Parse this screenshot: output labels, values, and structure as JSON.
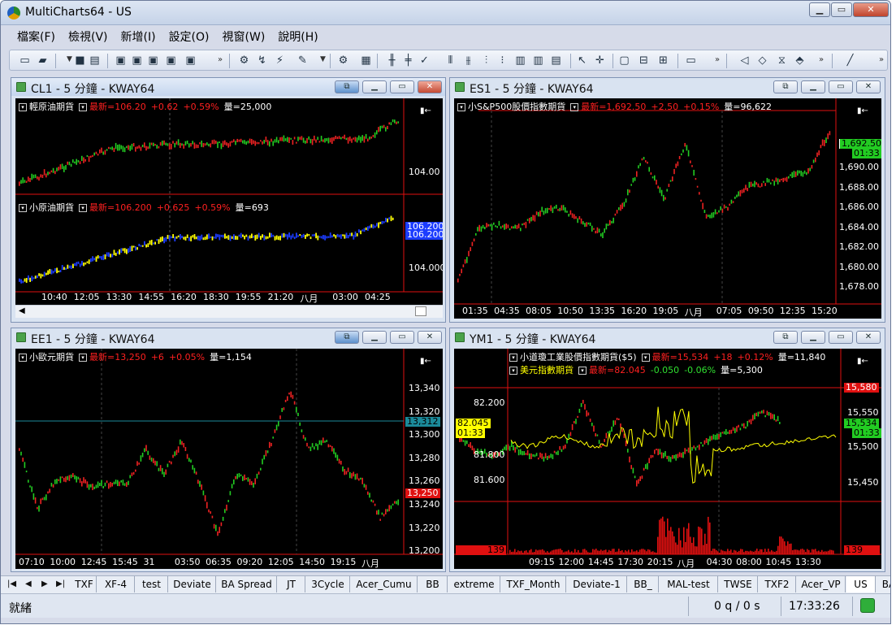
{
  "app": {
    "title": "MultiCharts64 - US"
  },
  "menu": [
    "檔案(F)",
    "檢視(V)",
    "新增(I)",
    "設定(O)",
    "視窗(W)",
    "說明(H)"
  ],
  "windows": [
    {
      "caption": "CL1 - 5 分鐘 - KWAY64",
      "legend1": {
        "name": "輕原油期貨",
        "last": "最新=106.20",
        "chg": "+0.62",
        "pct": "+0.59%",
        "vol": "量=25,000"
      },
      "legend2": {
        "name": "小原油期貨",
        "last": "最新=106.200",
        "chg": "+0.625",
        "pct": "+0.59%",
        "vol": "量=693"
      },
      "yticks1": [
        "104.00"
      ],
      "yticks2": [
        "104.000"
      ],
      "tags": [
        "106.200",
        "106.200"
      ],
      "xticks": [
        "10:40",
        "12:05",
        "13:30",
        "14:55",
        "16:20",
        "18:30",
        "19:55",
        "21:20",
        "八月",
        "03:00",
        "04:25"
      ]
    },
    {
      "caption": "ES1 - 5 分鐘 - KWAY64",
      "legend1": {
        "name": "小S&P500股價指數期貨",
        "last": "最新=1,692.50",
        "chg": "+2.50",
        "pct": "+0.15%",
        "vol": "量=96,622"
      },
      "yticks": [
        "1,690.00",
        "1,688.00",
        "1,686.00",
        "1,684.00",
        "1,682.00",
        "1,680.00",
        "1,678.00"
      ],
      "tags": [
        "1,692.50",
        "01:33"
      ],
      "xticks": [
        "01:35",
        "04:35",
        "08:05",
        "10:50",
        "13:35",
        "16:20",
        "19:05",
        "八月",
        "07:05",
        "09:50",
        "12:35",
        "15:20"
      ]
    },
    {
      "caption": "EE1 - 5 分鐘 - KWAY64",
      "legend1": {
        "name": "小歐元期貨",
        "last": "最新=13,250",
        "chg": "+6",
        "pct": "+0.05%",
        "vol": "量=1,154"
      },
      "yticks": [
        "13,340",
        "13,320",
        "13,300",
        "13,280",
        "13,260",
        "13,240",
        "13,220",
        "13,200"
      ],
      "tags": [
        "13,312",
        "13,250"
      ],
      "xticks": [
        "07:10",
        "10:00",
        "12:45",
        "15:45",
        "31",
        "03:50",
        "06:35",
        "09:20",
        "12:05",
        "14:50",
        "19:15",
        "八月"
      ]
    },
    {
      "caption": "YM1 - 5 分鐘 - KWAY64",
      "legend1": {
        "name": "小道瓊工業股價指數期貨($5)",
        "last": "最新=15,534",
        "chg": "+18",
        "pct": "+0.12%",
        "vol": "量=11,840"
      },
      "legend2": {
        "name": "美元指數期貨",
        "last": "最新=82.045",
        "chg": "-0.050",
        "pct": "-0.06%",
        "vol": "量=5,300"
      },
      "yticks_left": [
        "82.200",
        "81.800",
        "81.600"
      ],
      "yticks_right": [
        "15,550",
        "15,500",
        "15,450"
      ],
      "tags_left": [
        "82.045",
        "01:33",
        "139"
      ],
      "tags_right": [
        "15,580",
        "15,534",
        "01:33",
        "139"
      ],
      "xticks": [
        "09:15",
        "12:00",
        "14:45",
        "17:30",
        "20:15",
        "八月",
        "04:30",
        "08:00",
        "10:45",
        "13:30"
      ]
    }
  ],
  "tabs": [
    "TXF",
    "XF-4",
    "test",
    "Deviate",
    "BA Spread",
    "JT",
    "3Cycle",
    "Acer_Cumu",
    "BB",
    "extreme",
    "TXF_Month",
    "Deviate-1",
    "BB_",
    "MAL-test",
    "TWSE",
    "TXF2",
    "Acer_VP",
    "US",
    "BA Sp"
  ],
  "status": {
    "ready": "就緒",
    "queue": "0 q / 0 s",
    "time": "17:33:26"
  },
  "colors": {
    "bg": "#000000",
    "up": "#22cc22",
    "down": "#ee2222",
    "accent_series": "#ffff00",
    "blue_series": "#1c3cff"
  }
}
